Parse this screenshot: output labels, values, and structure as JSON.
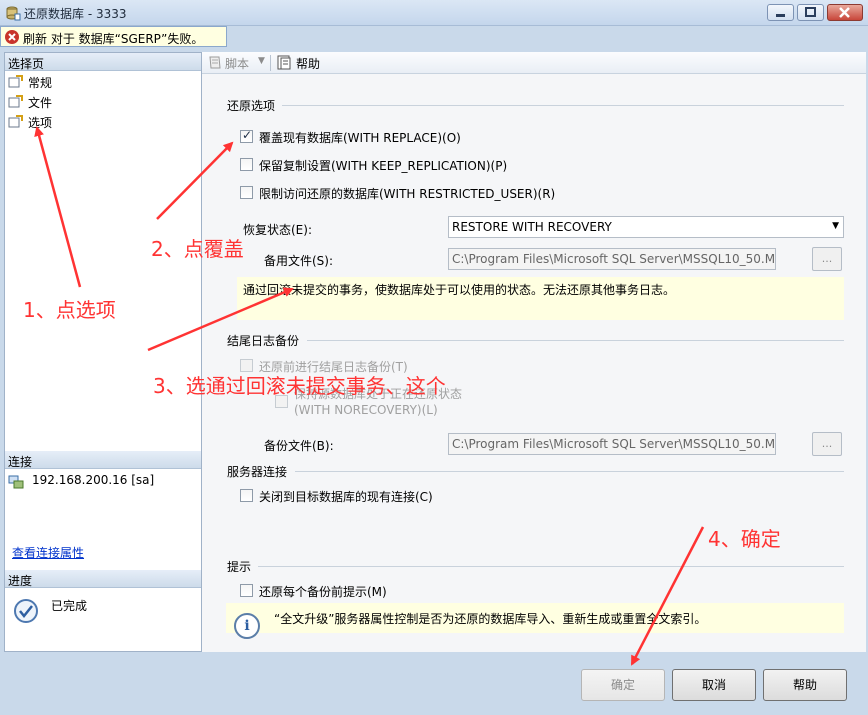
{
  "window": {
    "title": "还原数据库 - 3333",
    "error": "刷新 对于 数据库“SGERP”失败。"
  },
  "left": {
    "select_page_header": "选择页",
    "nav": [
      "常规",
      "文件",
      "选项"
    ],
    "connection_header": "连接",
    "connection_value": "192.168.200.16 [sa]",
    "connection_link": "查看连接属性",
    "progress_header": "进度",
    "progress_status": "已完成"
  },
  "toolbar": {
    "script": "脚本",
    "help": "帮助"
  },
  "restore_options": {
    "title": "还原选项",
    "overwrite": {
      "label": "覆盖现有数据库(WITH REPLACE)(O)",
      "checked": true
    },
    "keep_replication": {
      "label": "保留复制设置(WITH KEEP_REPLICATION)(P)",
      "checked": false
    },
    "restricted_user": {
      "label": "限制访问还原的数据库(WITH RESTRICTED_USER)(R)",
      "checked": false
    },
    "recovery_state_label": "恢复状态(E):",
    "recovery_state_value": "RESTORE WITH RECOVERY",
    "standby_file_label": "备用文件(S):",
    "standby_file_value": "C:\\Program Files\\Microsoft SQL Server\\MSSQL10_50.MS",
    "note": "通过回滚未提交的事务，使数据库处于可以使用的状态。无法还原其他事务日志。"
  },
  "tail_log": {
    "title": "结尾日志备份",
    "backup_before": "还原前进行结尾日志备份(T)",
    "leave_restoring_line1": "保持源数据库处于正在还原状态",
    "leave_restoring_line2": "(WITH NORECOVERY)(L)",
    "backup_file_label": "备份文件(B):",
    "backup_file_value": "C:\\Program Files\\Microsoft SQL Server\\MSSQL10_50.MS"
  },
  "server_connections": {
    "title": "服务器连接",
    "close_existing": "关闭到目标数据库的现有连接(C)"
  },
  "prompt": {
    "title": "提示",
    "prompt_before": "还原每个备份前提示(M)",
    "info": "“全文升级”服务器属性控制是否为还原的数据库导入、重新生成或重置全文索引。"
  },
  "buttons": {
    "ok": "确定",
    "cancel": "取消",
    "help": "帮助",
    "browse": "..."
  },
  "annotations": {
    "step1": "1、点选项",
    "step2": "2、点覆盖",
    "step3": "3、选通过回滚未提交事务、这个",
    "step4": "4、确定"
  },
  "colors": {
    "annotation": "#ff3333",
    "note_bg": "#ffffe1"
  }
}
